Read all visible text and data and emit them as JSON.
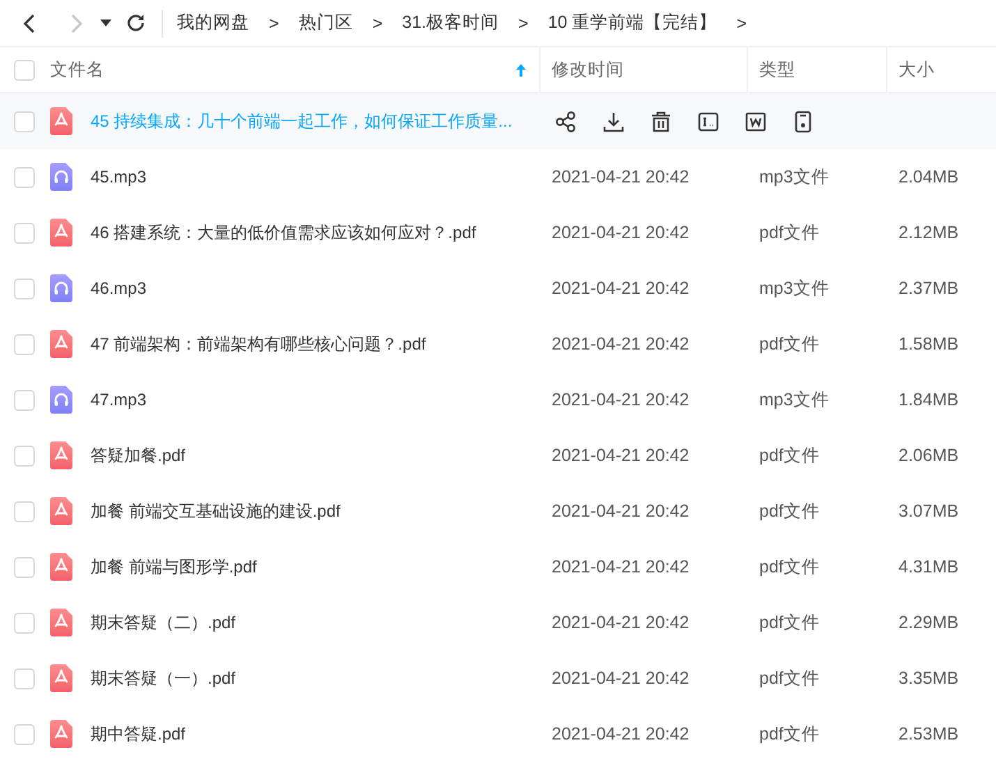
{
  "nav": {
    "back_disabled": false,
    "forward_disabled": true
  },
  "breadcrumb": [
    {
      "kind": "crumb",
      "text": "我的网盘"
    },
    {
      "kind": "separator",
      "text": ">"
    },
    {
      "kind": "crumb",
      "text": "热门区"
    },
    {
      "kind": "separator",
      "text": ">"
    },
    {
      "kind": "crumb",
      "text": "31.极客时间"
    },
    {
      "kind": "separator",
      "text": ">"
    },
    {
      "kind": "crumb",
      "text": "10 重学前端【完结】"
    },
    {
      "kind": "separator",
      "text": ">"
    }
  ],
  "table": {
    "all_checked": false,
    "columns": [
      {
        "label": "文件名",
        "sorted": true
      },
      {
        "label": "修改时间",
        "sorted": false
      },
      {
        "label": "类型",
        "sorted": false
      },
      {
        "label": "大小",
        "sorted": false
      }
    ],
    "rows": [
      {
        "kind": "pdf",
        "name": "45 持续集成：几十个前端一起工作，如何保证工作质量...",
        "checked": false,
        "hovered": true
      },
      {
        "kind": "mp3",
        "name": "45.mp3",
        "checked": false,
        "hovered": false,
        "modified": "2021-04-21 20:42",
        "type": "mp3文件",
        "size": "2.04MB"
      },
      {
        "kind": "pdf",
        "name": "46 搭建系统：大量的低价值需求应该如何应对？.pdf",
        "checked": false,
        "hovered": false,
        "modified": "2021-04-21 20:42",
        "type": "pdf文件",
        "size": "2.12MB"
      },
      {
        "kind": "mp3",
        "name": "46.mp3",
        "checked": false,
        "hovered": false,
        "modified": "2021-04-21 20:42",
        "type": "mp3文件",
        "size": "2.37MB"
      },
      {
        "kind": "pdf",
        "name": "47 前端架构：前端架构有哪些核心问题？.pdf",
        "checked": false,
        "hovered": false,
        "modified": "2021-04-21 20:42",
        "type": "pdf文件",
        "size": "1.58MB"
      },
      {
        "kind": "mp3",
        "name": "47.mp3",
        "checked": false,
        "hovered": false,
        "modified": "2021-04-21 20:42",
        "type": "mp3文件",
        "size": "1.84MB"
      },
      {
        "kind": "pdf",
        "name": "答疑加餐.pdf",
        "checked": false,
        "hovered": false,
        "modified": "2021-04-21 20:42",
        "type": "pdf文件",
        "size": "2.06MB"
      },
      {
        "kind": "pdf",
        "name": "加餐  前端交互基础设施的建设.pdf",
        "checked": false,
        "hovered": false,
        "modified": "2021-04-21 20:42",
        "type": "pdf文件",
        "size": "3.07MB"
      },
      {
        "kind": "pdf",
        "name": "加餐  前端与图形学.pdf",
        "checked": false,
        "hovered": false,
        "modified": "2021-04-21 20:42",
        "type": "pdf文件",
        "size": "4.31MB"
      },
      {
        "kind": "pdf",
        "name": "期末答疑（二）.pdf",
        "checked": false,
        "hovered": false,
        "modified": "2021-04-21 20:42",
        "type": "pdf文件",
        "size": "2.29MB"
      },
      {
        "kind": "pdf",
        "name": "期末答疑（一）.pdf",
        "checked": false,
        "hovered": false,
        "modified": "2021-04-21 20:42",
        "type": "pdf文件",
        "size": "3.35MB"
      },
      {
        "kind": "pdf",
        "name": "期中答疑.pdf",
        "checked": false,
        "hovered": false,
        "modified": "2021-04-21 20:42",
        "type": "pdf文件",
        "size": "2.53MB"
      }
    ]
  }
}
